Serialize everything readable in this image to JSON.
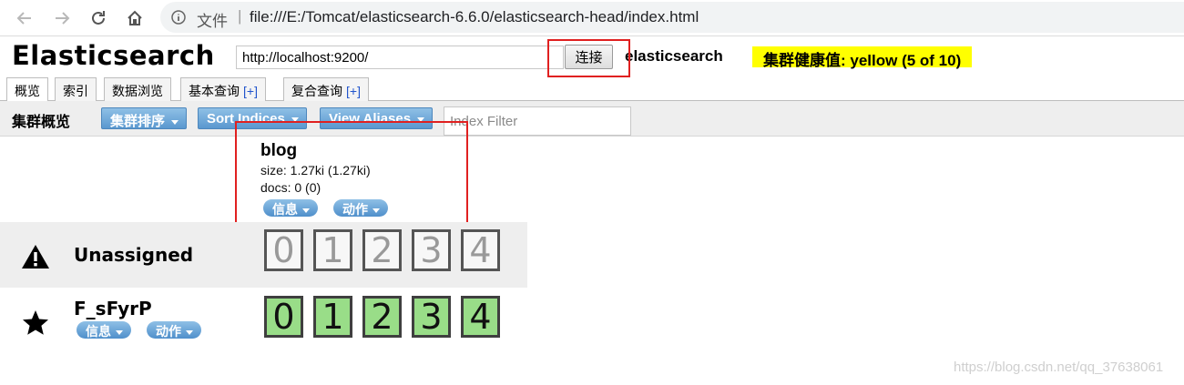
{
  "browser": {
    "file_label": "文件",
    "separator": "|",
    "url": "file:///E:/Tomcat/elasticsearch-6.6.0/elasticsearch-head/index.html"
  },
  "header": {
    "brand": "Elasticsearch",
    "url_value": "http://localhost:9200/",
    "connect_label": "连接",
    "cluster_name": "elasticsearch",
    "health_text": "集群健康值: yellow (5 of 10)",
    "health_color": "#ffff00"
  },
  "tabs": [
    {
      "label": "概览",
      "plus": ""
    },
    {
      "label": "索引",
      "plus": ""
    },
    {
      "label": "数据浏览",
      "plus": ""
    },
    {
      "label": "基本查询",
      "plus": "[+]"
    },
    {
      "label": "复合查询",
      "plus": "[+]"
    }
  ],
  "toolbar": {
    "title": "集群概览",
    "sort_cluster": "集群排序",
    "sort_indices": "Sort Indices",
    "view_aliases": "View Aliases",
    "filter_placeholder": "Index Filter"
  },
  "index": {
    "name": "blog",
    "size": "size: 1.27ki (1.27ki)",
    "docs": "docs: 0 (0)",
    "info_label": "信息",
    "action_label": "动作"
  },
  "nodes": {
    "unassigned": {
      "label": "Unassigned",
      "icon": "warning-icon",
      "shards": [
        "0",
        "1",
        "2",
        "3",
        "4"
      ]
    },
    "node": {
      "label": "F_sFyrP",
      "icon": "star-icon",
      "info_label": "信息",
      "action_label": "动作",
      "shards": [
        "0",
        "1",
        "2",
        "3",
        "4"
      ],
      "shard_color": "#99dd88"
    }
  },
  "watermark": "https://blog.csdn.net/qq_37638061"
}
